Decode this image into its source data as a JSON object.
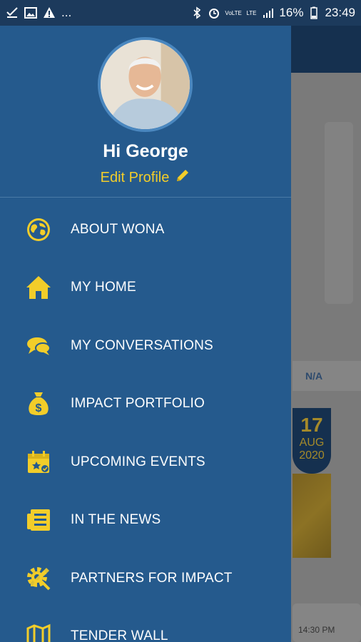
{
  "status_bar": {
    "left_icons": [
      "download-done-icon",
      "image-icon",
      "warning-icon"
    ],
    "left_more": "...",
    "network_1": "VoLTE",
    "network_2": "LTE",
    "battery_percent": "16%",
    "time": "23:49"
  },
  "profile": {
    "greeting": "Hi George",
    "edit_label": "Edit Profile"
  },
  "menu": [
    {
      "label": "ABOUT WONA",
      "icon": "globe-icon"
    },
    {
      "label": "MY HOME",
      "icon": "home-icon"
    },
    {
      "label": "MY CONVERSATIONS",
      "icon": "chat-bubbles-icon"
    },
    {
      "label": "IMPACT PORTFOLIO",
      "icon": "money-bag-icon"
    },
    {
      "label": "UPCOMING EVENTS",
      "icon": "calendar-icon"
    },
    {
      "label": "IN THE NEWS",
      "icon": "newspaper-icon"
    },
    {
      "label": "PARTNERS FOR IMPACT",
      "icon": "gear-tools-icon"
    },
    {
      "label": "TENDER WALL",
      "icon": "map-icon"
    }
  ],
  "background": {
    "badge": "N/A",
    "date_day": "17",
    "date_month": "AUG",
    "date_year": "2020",
    "time_fragment": "14:30 PM"
  },
  "colors": {
    "drawer": "#255a8d",
    "accent": "#f2cd2a",
    "status_bar": "#1c3a5c"
  }
}
